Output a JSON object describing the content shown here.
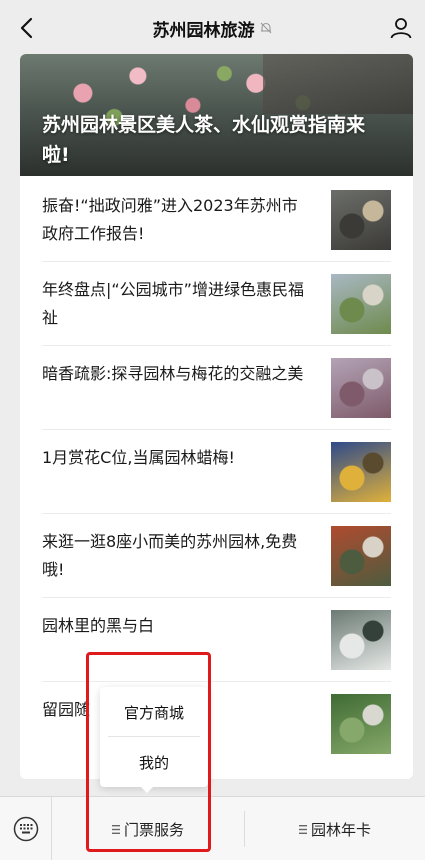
{
  "nav": {
    "title": "苏州园林旅游",
    "icons": {
      "back": "chevron-left-icon",
      "mute": "bell-muted-icon",
      "profile": "user-icon"
    }
  },
  "hero": {
    "title": "苏州园林景区美人茶、水仙观赏指南来啦!"
  },
  "articles": [
    {
      "title": "振奋!“拙政问雅”进入2023年苏州市政府工作报告!",
      "thumb_colors": [
        "#6c6e6a",
        "#3b3a36",
        "#c7b79a"
      ]
    },
    {
      "title": "年终盘点|“公园城市”增进绿色惠民福祉",
      "thumb_colors": [
        "#a9b8c3",
        "#6f8a4d",
        "#d8d4c8"
      ]
    },
    {
      "title": "暗香疏影:探寻园林与梅花的交融之美",
      "thumb_colors": [
        "#b3a4b6",
        "#7e5a6a",
        "#c9c2c8"
      ]
    },
    {
      "title": "1月赏花C位,当属园林蜡梅!",
      "thumb_colors": [
        "#2e4a8a",
        "#e0b13a",
        "#5a4a2e"
      ]
    },
    {
      "title": "来逛一逛8座小而美的苏州园林,免费哦!",
      "thumb_colors": [
        "#b04b2f",
        "#4d5c3f",
        "#d9d2c6"
      ]
    },
    {
      "title": "园林里的黑与白",
      "thumb_colors": [
        "#6c7a74",
        "#e5e8e6",
        "#33413a"
      ]
    },
    {
      "title": "留园随",
      "thumb_colors": [
        "#3f6b34",
        "#86a86a",
        "#d8d8d0"
      ]
    }
  ],
  "popup_menu": {
    "items": [
      "官方商城",
      "我的"
    ]
  },
  "bottom_menu": {
    "keyboard_icon": "keyboard-icon",
    "items": [
      "门票服务",
      "园林年卡"
    ],
    "item_icon": "list-icon"
  },
  "colors": {
    "highlight": "#e0191d",
    "background": "#ededed"
  }
}
